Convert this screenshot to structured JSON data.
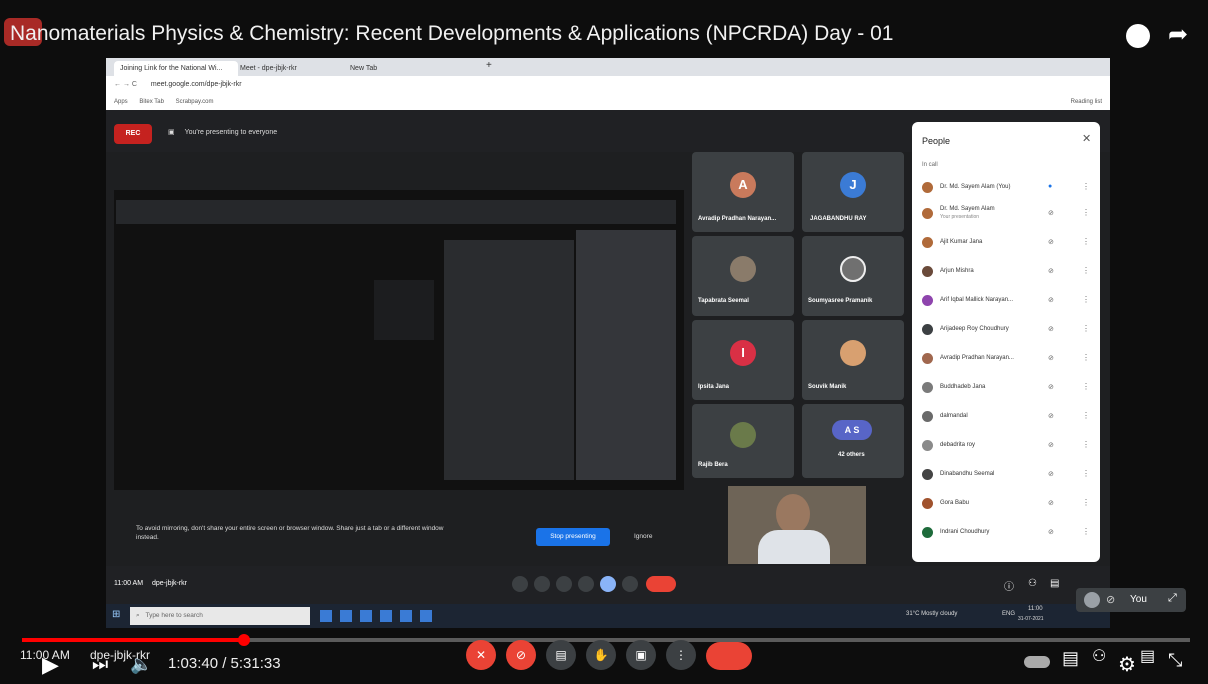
{
  "video": {
    "title": "Nanomaterials Physics & Chemistry: Recent Developments & Applications (NPCRDA) Day - 01",
    "time_current": "1:03:40",
    "time_total": "5:31:33",
    "time_display": "1:03:40 / 5:31:33",
    "progress": 0.19,
    "overlay_clock": "11:00 AM",
    "overlay_code": "dpe-jbjk-rkr"
  },
  "browser": {
    "tabs": [
      "Joining Link for the National Wi...",
      "Meet - dpe-jbjk-rkr",
      "New Tab"
    ],
    "url": "meet.google.com/dpe-jbjk-rkr",
    "bookmarks": [
      "Apps",
      "Bitex Tab",
      "Scrabpay.com"
    ],
    "reading_list": "Reading list"
  },
  "meet": {
    "rec_label": "REC",
    "presenting_banner": "You're presenting to everyone",
    "mirror_warning": "To avoid mirroring, don't share your entire screen or browser window. Share just a tab or a different window instead.",
    "stop_presenting": "Stop presenting",
    "ignore": "Ignore",
    "bottom_time": "11:00 AM",
    "bottom_code": "dpe-jbjk-rkr",
    "tiles": [
      {
        "name": "Avradip Pradhan Narayan...",
        "initial": "A",
        "color": "#c97a5c"
      },
      {
        "name": "JAGABANDHU RAY",
        "initial": "J",
        "color": "#3b7bd5"
      },
      {
        "name": "Tapabrata Seemal",
        "initial": "",
        "color": "#8a7b6a"
      },
      {
        "name": "Soumyasree Pramanik",
        "initial": "",
        "color": "#707070"
      },
      {
        "name": "Ipsita Jana",
        "initial": "I",
        "color": "#d93045"
      },
      {
        "name": "Souvik Manik",
        "initial": "",
        "color": "#d8a070"
      },
      {
        "name": "Rajib Bera",
        "initial": "",
        "color": "#6a7a4a"
      },
      {
        "name": "42 others",
        "initial": "A S",
        "color": "#5865c7"
      }
    ]
  },
  "people": {
    "title": "People",
    "section": "In call",
    "list": [
      {
        "name": "Dr. Md. Sayem Alam (You)",
        "color": "#b06a3a"
      },
      {
        "name": "Dr. Md. Sayem Alam",
        "sub": "Your presentation",
        "color": "#b06a3a"
      },
      {
        "name": "Ajit Kumar Jana",
        "color": "#b06a3a"
      },
      {
        "name": "Arjun Mishra",
        "color": "#6a4a3a"
      },
      {
        "name": "Arif Iqbal Mallick Narayan...",
        "color": "#8e44ad"
      },
      {
        "name": "Arijadeep Roy Choudhury",
        "color": "#3c4043"
      },
      {
        "name": "Avradip Pradhan Narayan...",
        "color": "#a0674e"
      },
      {
        "name": "Buddhadeb Jana",
        "color": "#7a7a7a"
      },
      {
        "name": "dalmandal",
        "color": "#6a6a6a"
      },
      {
        "name": "debadrita roy",
        "color": "#8a8a8a"
      },
      {
        "name": "Dinabandhu Seemal",
        "color": "#444"
      },
      {
        "name": "Gora Babu",
        "color": "#a0522d"
      },
      {
        "name": "Indrani Choudhury",
        "color": "#1e6b3b"
      }
    ]
  },
  "taskbar": {
    "search_placeholder": "Type here to search",
    "weather": "31°C Mostly cloudy",
    "tray_lang": "ENG",
    "tray_time": "11:00",
    "tray_date": "31-07-2021"
  },
  "you_chip": "You",
  "colors": {
    "accent": "#ff0000",
    "end_call": "#ea4335",
    "meet_blue": "#1a73e8"
  }
}
